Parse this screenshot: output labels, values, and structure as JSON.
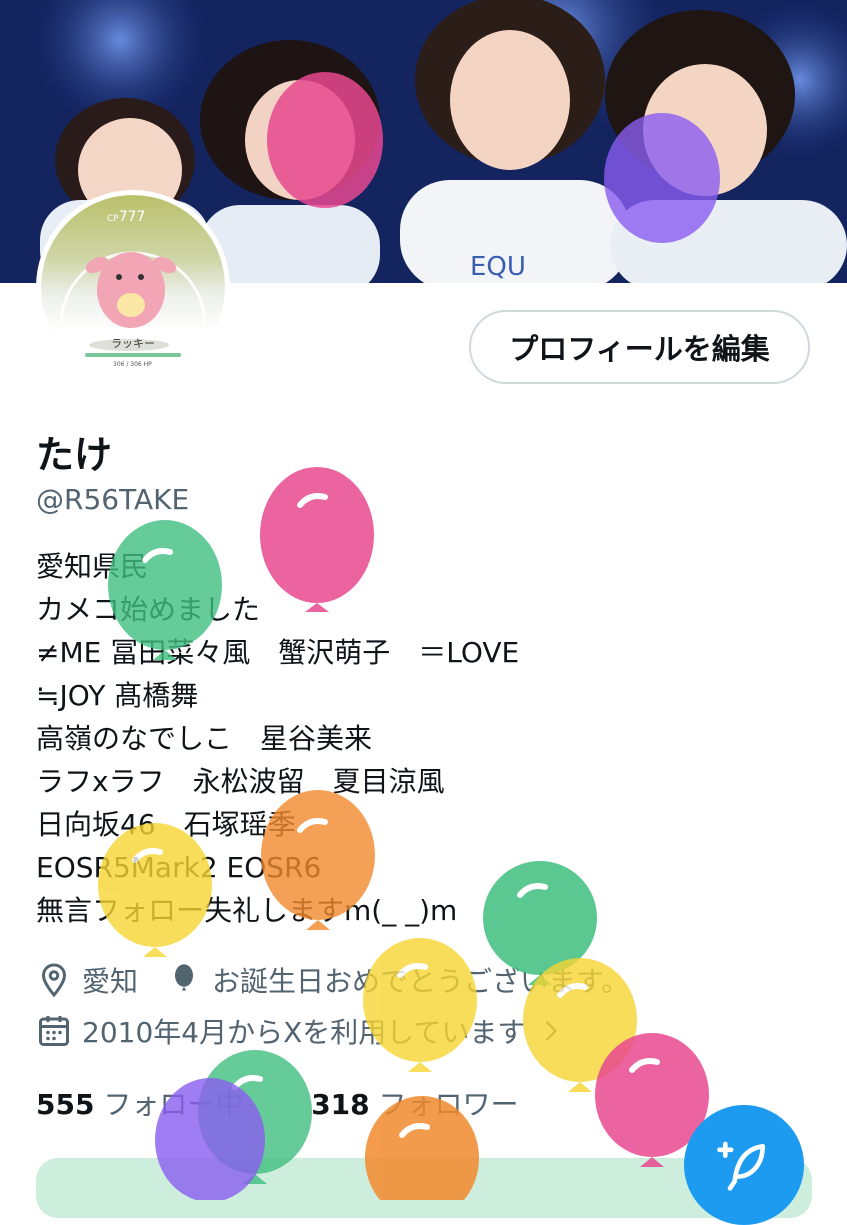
{
  "header": {
    "edit_profile_label": "プロフィールを編集"
  },
  "avatar": {
    "cp_prefix": "CP",
    "cp_value": "777",
    "pokemon_name": "ラッキー",
    "hp_text": "306 / 306 HP"
  },
  "profile": {
    "display_name": "たけ",
    "handle": "@R56TAKE",
    "bio_lines": [
      "愛知県民",
      "カメコ始めました",
      "≠ME 冨田菜々風　蟹沢萌子　＝LOVE",
      "≒JOY 髙橋舞",
      "高嶺のなでしこ　星谷美来",
      "ラフxラフ　永松波留　夏目涼風",
      "日向坂46　石塚瑶季",
      "EOSR5Mark2 EOSR6",
      "無言フォロー失礼しますm(_ _)m"
    ],
    "location": "愛知",
    "birthday_text": "お誕生日おめでとうございます。",
    "joined_text": "2010年4月からXを利用しています",
    "following_count": "555",
    "following_label": "フォロー中",
    "followers_count": "318",
    "followers_label": "フォロワー"
  },
  "colors": {
    "accent": "#1d9bf0",
    "secondary_text": "#536471",
    "balloon_pink": "#e8488f",
    "balloon_green": "#3fbf7f",
    "balloon_yellow": "#f7d533",
    "balloon_orange": "#f28a2e",
    "balloon_purple": "#8a5cf0"
  },
  "icons": [
    "location-pin-icon",
    "balloon-icon",
    "calendar-icon",
    "chevron-right-icon",
    "compose-post-icon"
  ]
}
